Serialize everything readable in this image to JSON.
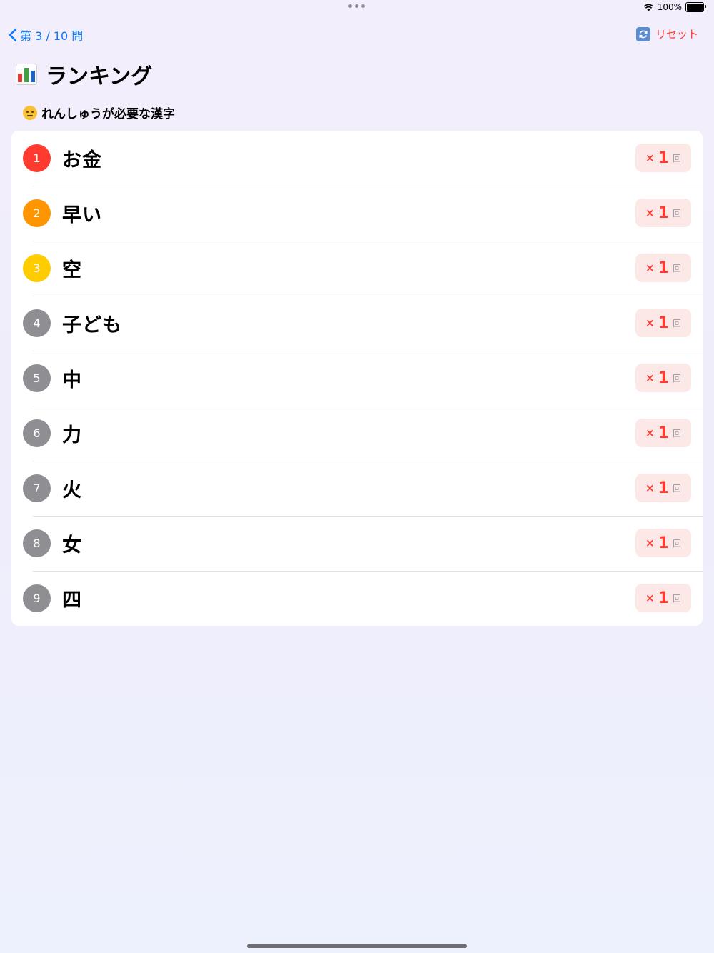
{
  "status_bar": {
    "battery": "100%",
    "battery_level": 1.0
  },
  "nav": {
    "back_label": "第 3 / 10 問",
    "reset_label": "リセット"
  },
  "page": {
    "title": "ランキング"
  },
  "section": {
    "label": "れんしゅうが必要な漢字"
  },
  "ranking": {
    "items": [
      {
        "rank": "1",
        "kanji": "お金",
        "x": "×",
        "count": "1",
        "unit": "回",
        "color": "#ff3b30"
      },
      {
        "rank": "2",
        "kanji": "早い",
        "x": "×",
        "count": "1",
        "unit": "回",
        "color": "#ff9500"
      },
      {
        "rank": "3",
        "kanji": "空",
        "x": "×",
        "count": "1",
        "unit": "回",
        "color": "#ffcc00"
      },
      {
        "rank": "4",
        "kanji": "子ども",
        "x": "×",
        "count": "1",
        "unit": "回",
        "color": "#8e8e93"
      },
      {
        "rank": "5",
        "kanji": "中",
        "x": "×",
        "count": "1",
        "unit": "回",
        "color": "#8e8e93"
      },
      {
        "rank": "6",
        "kanji": "力",
        "x": "×",
        "count": "1",
        "unit": "回",
        "color": "#8e8e93"
      },
      {
        "rank": "7",
        "kanji": "火",
        "x": "×",
        "count": "1",
        "unit": "回",
        "color": "#8e8e93"
      },
      {
        "rank": "8",
        "kanji": "女",
        "x": "×",
        "count": "1",
        "unit": "回",
        "color": "#8e8e93"
      },
      {
        "rank": "9",
        "kanji": "四",
        "x": "×",
        "count": "1",
        "unit": "回",
        "color": "#8e8e93"
      }
    ]
  },
  "colors": {
    "accent": "#0a7aff",
    "danger": "#ff3b30",
    "badge_bg": "#fde8e8"
  }
}
